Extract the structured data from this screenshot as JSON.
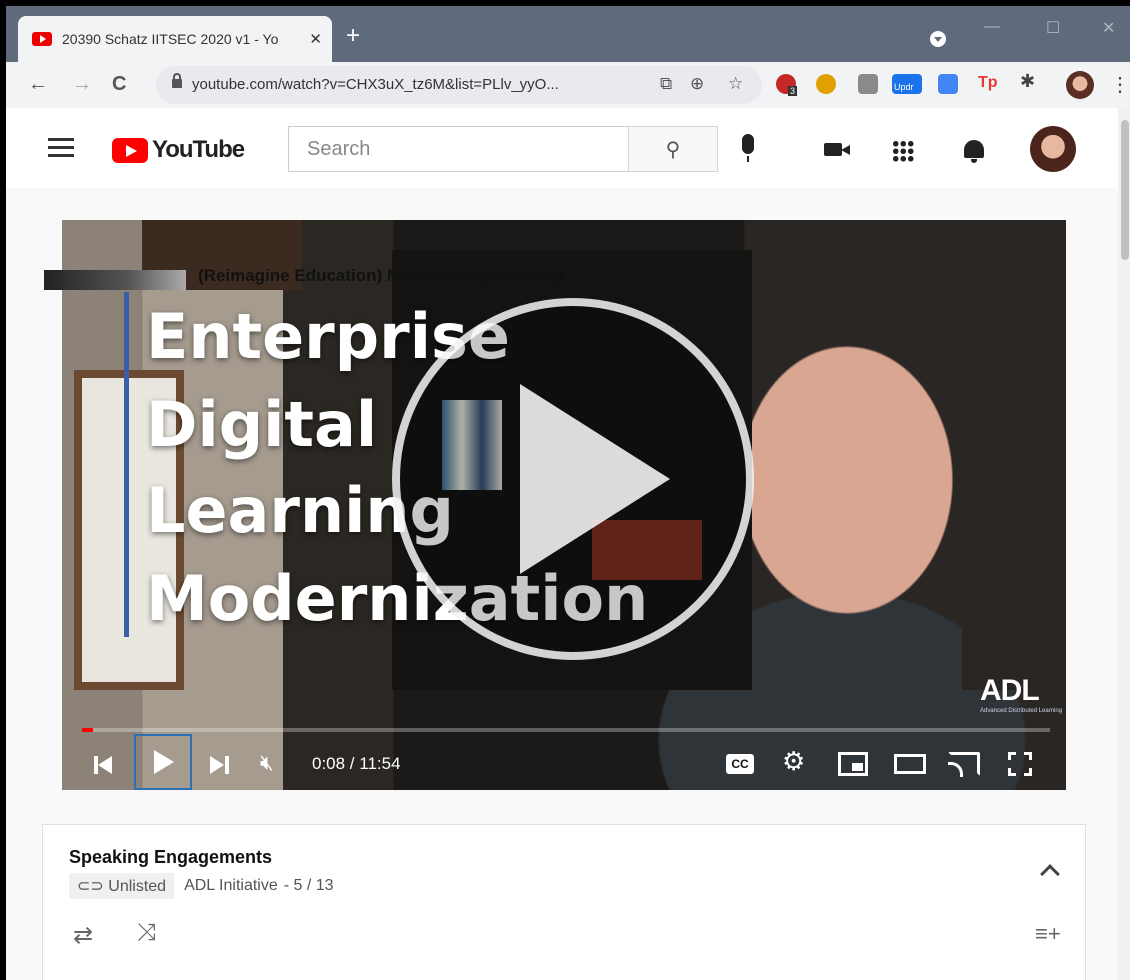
{
  "browser": {
    "tab_title": "20390 Schatz IITSEC 2020 v1 - Yo",
    "tab_close": "✕",
    "new_tab": "+",
    "url": "youtube.com/watch?v=CHX3uX_tz6M&list=PLlv_yyO...",
    "minimize": "—",
    "maximize": "☐",
    "close": "✕",
    "back": "←",
    "forward": "→",
    "reload": "C",
    "omnibox_icons": [
      "install-icon",
      "zoom-icon",
      "star-icon"
    ],
    "extensions": [
      {
        "name": "abp-extension-icon",
        "color": "#c62828",
        "badge": "3"
      },
      {
        "name": "honey-extension-icon",
        "color": "#e0a100"
      },
      {
        "name": "google-extension-icon",
        "color": "#8a8a8a"
      },
      {
        "name": "update-extension-icon",
        "color": "#1a73e8",
        "label": "Updr"
      },
      {
        "name": "docs-extension-icon",
        "color": "#4285f4"
      },
      {
        "name": "tp-extension-icon",
        "color": "#e53935",
        "label": "Tp"
      },
      {
        "name": "puzzle-extension-icon",
        "color": "#444"
      }
    ]
  },
  "youtube": {
    "logo_text": "YouTube",
    "search_placeholder": "Search",
    "search_icon": "⚲"
  },
  "video": {
    "title_lines": [
      "Enterprise",
      "Digital",
      "Learning",
      "Modernization"
    ],
    "watermark": "ADL",
    "watermark_sub": "Advanced Distributed Learning",
    "current_time": "0:08",
    "duration": "11:54",
    "time_display": "0:08 / 11:54",
    "progress_fraction": 0.011,
    "muted": true,
    "cc_label": "CC"
  },
  "playlist": {
    "title": "Speaking Engagements",
    "visibility": "Unlisted",
    "visibility_icon": "link-icon",
    "owner": "ADL Initiative",
    "position": "- 5 / 13",
    "next_item_title": "(Reimagine Education) Modernizing Learning"
  },
  "colors": {
    "accent": "#ff0000",
    "play_focus": "#2c6fb4",
    "title_bar": "#3a5ea8"
  }
}
